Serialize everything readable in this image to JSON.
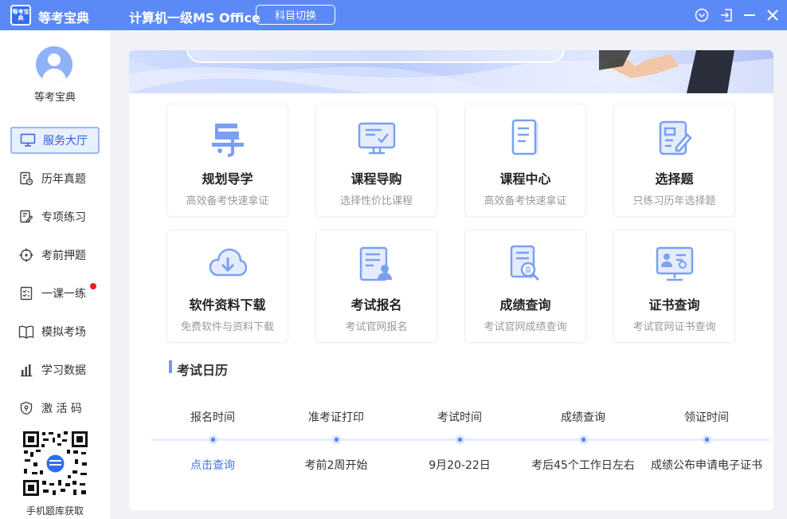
{
  "titlebar": {
    "logo_text": "等考宝典",
    "app_name": "等考宝典",
    "subject": "计算机一级MS Office",
    "switch_label": "科目切换"
  },
  "sidebar": {
    "user_name": "等考宝典",
    "items": [
      {
        "label": "服务大厅",
        "icon": "monitor-icon",
        "active": true
      },
      {
        "label": "历年真题",
        "icon": "document-clock-icon"
      },
      {
        "label": "专项练习",
        "icon": "edit-document-icon"
      },
      {
        "label": "考前押题",
        "icon": "crosshair-icon"
      },
      {
        "label": "一课一练",
        "icon": "checklist-icon"
      },
      {
        "label": "模拟考场",
        "icon": "book-open-icon"
      },
      {
        "label": "学习数据",
        "icon": "bar-chart-icon"
      },
      {
        "label": "激 活 码",
        "icon": "shield-icon"
      }
    ],
    "qr_caption": "手机题库获取"
  },
  "tiles": [
    {
      "title": "规划导学",
      "subtitle": "高效备考快速拿证",
      "icon": "guide-icon"
    },
    {
      "title": "课程导购",
      "subtitle": "选择性价比课程",
      "icon": "screen-check-icon"
    },
    {
      "title": "课程中心",
      "subtitle": "高效备考快速拿证",
      "icon": "document-stack-icon"
    },
    {
      "title": "选择题",
      "subtitle": "只练习历年选择题",
      "icon": "edit-form-icon"
    },
    {
      "title": "软件资料下载",
      "subtitle": "免费软件与资料下载",
      "icon": "cloud-download-icon"
    },
    {
      "title": "考试报名",
      "subtitle": "考试官网报名",
      "icon": "registration-icon"
    },
    {
      "title": "成绩查询",
      "subtitle": "考试官网成绩查询",
      "icon": "score-search-icon"
    },
    {
      "title": "证书查询",
      "subtitle": "考试官网证书查询",
      "icon": "certificate-search-icon"
    }
  ],
  "calendar": {
    "title": "考试日历",
    "columns": [
      {
        "head": "报名时间",
        "value": "点击查询",
        "link": true
      },
      {
        "head": "准考证打印",
        "value": "考前2周开始"
      },
      {
        "head": "考试时间",
        "value": "9月20-22日"
      },
      {
        "head": "成绩查询",
        "value": "考后45个工作日左右"
      },
      {
        "head": "领证时间",
        "value": "成绩公布申请电子证书"
      }
    ]
  },
  "colors": {
    "brand": "#5b8af7",
    "accent": "#3f74e8",
    "icon": "#6f98f2"
  }
}
